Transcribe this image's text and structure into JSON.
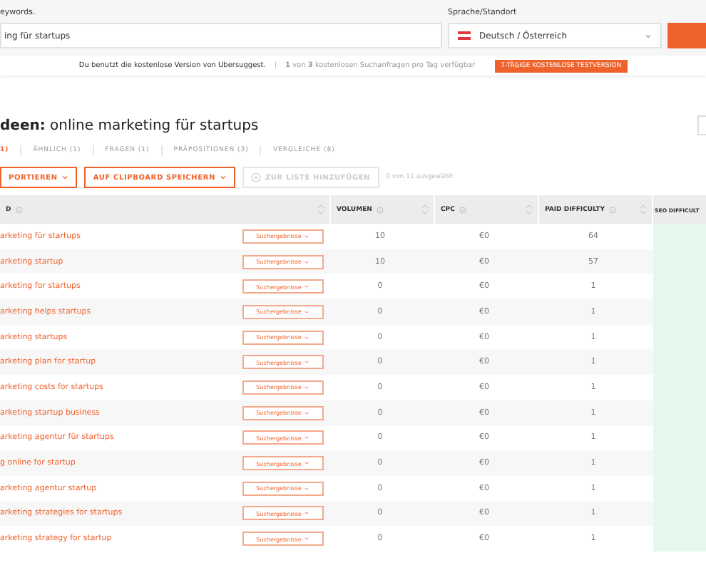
{
  "search": {
    "label": "eywords.",
    "value": "ing für startups"
  },
  "locale": {
    "label": "Sprache/Standort",
    "value": "Deutsch / Österreich"
  },
  "banner": {
    "text": "Du benutzt die kostenlose Version von Ubersuggest.",
    "separator": "|",
    "quota": "**1** von **3** kostenlosen Suchanfragen pro Tag verfügbar",
    "trial_button": "7-TÄGIGE KOSTENLOSE TESTVERSION"
  },
  "heading": "**deen:** online marketing für startups",
  "tabs": [
    {
      "label": "1)",
      "selected": true
    },
    {
      "label": "ÄHNLICH (1)",
      "selected": false
    },
    {
      "label": "FRAGEN (1)",
      "selected": false
    },
    {
      "label": "PRÄPOSITIONEN (3)",
      "selected": false
    },
    {
      "label": "VERGLEICHE (8)",
      "selected": false
    }
  ],
  "actions": [
    {
      "label": "PORTIEREN",
      "kind": "dropdown",
      "disabled": false
    },
    {
      "label": "AUF CLIPBOARD SPEICHERN",
      "kind": "dropdown",
      "disabled": false
    },
    {
      "label": "ZUR LISTE HINZUFÜGEN",
      "kind": "add",
      "disabled": true
    }
  ],
  "selection_count": "0 von 11 ausgewählt",
  "table": {
    "columns": [
      {
        "label": "D"
      },
      {
        "label": "VOLUMEN"
      },
      {
        "label": "CPC"
      },
      {
        "label": "PAID DIFFICULTY"
      },
      {
        "label": "SEO DIFFICULT"
      }
    ],
    "rows": [
      {
        "keyword": "arketing für startups",
        "action": "Suchergebnisse",
        "volume": "10",
        "cpc": "€0",
        "paid_difficulty": "64"
      },
      {
        "keyword": "arketing startup",
        "action": "Suchergebnisse",
        "volume": "10",
        "cpc": "€0",
        "paid_difficulty": "57"
      },
      {
        "keyword": "arketing for startups",
        "action": "Suchergebnisse",
        "volume": "0",
        "cpc": "€0",
        "paid_difficulty": "1"
      },
      {
        "keyword": "arketing helps startups",
        "action": "Suchergebnisse",
        "volume": "0",
        "cpc": "€0",
        "paid_difficulty": "1"
      },
      {
        "keyword": "arketing startups",
        "action": "Suchergebnisse",
        "volume": "0",
        "cpc": "€0",
        "paid_difficulty": "1"
      },
      {
        "keyword": "arketing plan for startup",
        "action": "Suchergebnisse",
        "volume": "0",
        "cpc": "€0",
        "paid_difficulty": "1"
      },
      {
        "keyword": "arketing costs for startups",
        "action": "Suchergebnisse",
        "volume": "0",
        "cpc": "€0",
        "paid_difficulty": "1"
      },
      {
        "keyword": "arketing startup business",
        "action": "Suchergebnisse",
        "volume": "0",
        "cpc": "€0",
        "paid_difficulty": "1"
      },
      {
        "keyword": "arketing agentur für startups",
        "action": "Suchergebnisse",
        "volume": "0",
        "cpc": "€0",
        "paid_difficulty": "1"
      },
      {
        "keyword": "g online for startup",
        "action": "Suchergebnisse",
        "volume": "0",
        "cpc": "€0",
        "paid_difficulty": "1"
      },
      {
        "keyword": "arketing agentur startup",
        "action": "Suchergebnisse",
        "volume": "0",
        "cpc": "€0",
        "paid_difficulty": "1"
      },
      {
        "keyword": "arketing strategies for startups",
        "action": "Suchergebnisse",
        "volume": "0",
        "cpc": "€0",
        "paid_difficulty": "1"
      },
      {
        "keyword": "arketing strategy for startup",
        "action": "Suchergebnisse",
        "volume": "0",
        "cpc": "€0",
        "paid_difficulty": "1"
      }
    ]
  }
}
